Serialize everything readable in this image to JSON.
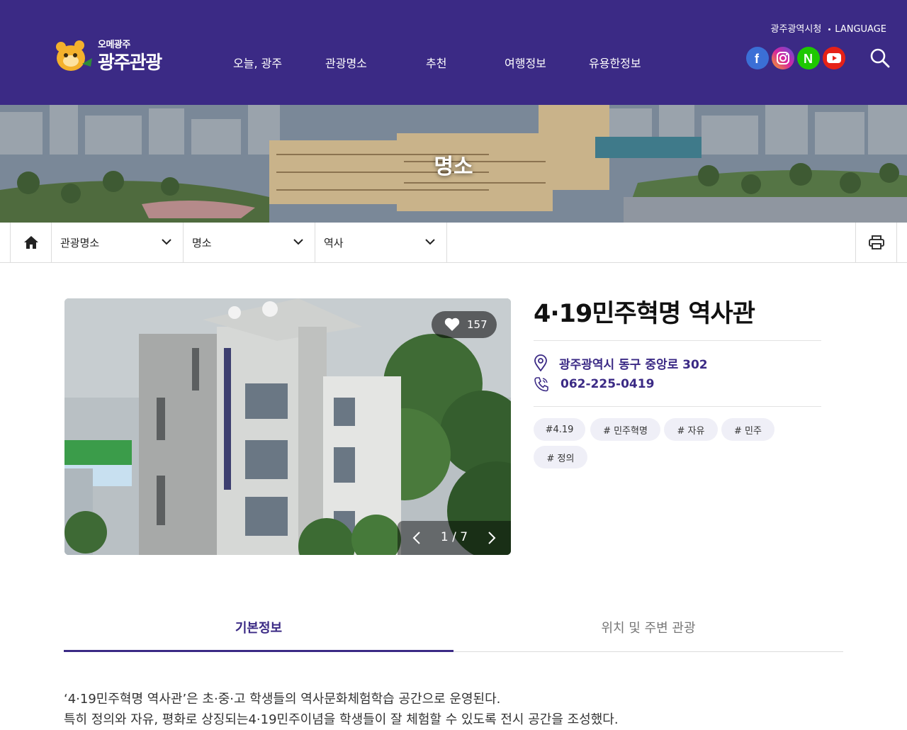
{
  "header": {
    "logo_small": "오메광주",
    "logo_big": "광주관광",
    "nav": [
      "오늘, 광주",
      "관광명소",
      "추천",
      "여행정보",
      "유용한정보"
    ],
    "util_city": "광주광역시청",
    "util_language": "LANGUAGE",
    "sns": [
      {
        "name": "facebook",
        "glyph": "f",
        "color": "#3b6fd6"
      },
      {
        "name": "instagram",
        "glyph": "◎",
        "color": "#c13584"
      },
      {
        "name": "naver",
        "glyph": "N",
        "color": "#1ec800"
      },
      {
        "name": "youtube",
        "glyph": "▶",
        "color": "#e62117"
      }
    ],
    "search_icon": "search-icon",
    "bg_color": "#3b2a85"
  },
  "banner": {
    "title": "명소"
  },
  "location": {
    "home_icon": "home-icon",
    "selects": [
      "관광명소",
      "명소",
      "역사"
    ],
    "print_icon": "print-icon"
  },
  "gallery": {
    "likes": "157",
    "page": "1 / 7",
    "heart_icon": "heart-icon"
  },
  "place": {
    "title": "4·19민주혁명 역사관",
    "address": "광주광역시 동구 중앙로 302",
    "phone": "062-225-0419",
    "tags": [
      "#4.19",
      "# 민주혁명",
      "# 자유",
      "# 민주",
      "# 정의"
    ],
    "accent_color": "#3b2a85"
  },
  "tabs": [
    "기본정보",
    "위치 및 주변 관광"
  ],
  "description": [
    "‘4·19민주혁명 역사관’은 초·중·고 학생들의 역사문화체험학습 공간으로 운영된다.",
    "특히 정의와 자유, 평화로 상징되는4·19민주이념을 학생들이 잘 체험할 수 있도록 전시 공간을 조성했다."
  ]
}
